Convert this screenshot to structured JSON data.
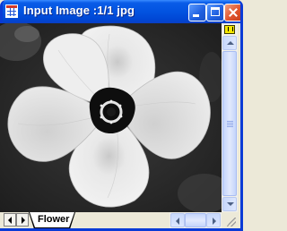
{
  "window": {
    "title": "Input Image :1/1 jpg",
    "icon": "worksheet-icon",
    "buttons": {
      "minimize": "minimize-icon",
      "maximize": "maximize-icon",
      "close": "close-icon"
    }
  },
  "image": {
    "subject": "grayscale flower photograph",
    "colors": {
      "background": "#2a2a2a",
      "petals": "#e6e6e6",
      "center": "#101010"
    }
  },
  "sheet_tabs": [
    {
      "label": "Flower",
      "active": true
    }
  ],
  "vertical_scroll": {
    "indicator": "yellow-marker-icon",
    "position": 0.0
  },
  "horizontal_scroll": {
    "position": 0.0
  },
  "colors": {
    "titlebar": "#0253e0",
    "frame": "#0a3bd6",
    "close_button": "#e0552e",
    "face": "#ece9d8"
  }
}
